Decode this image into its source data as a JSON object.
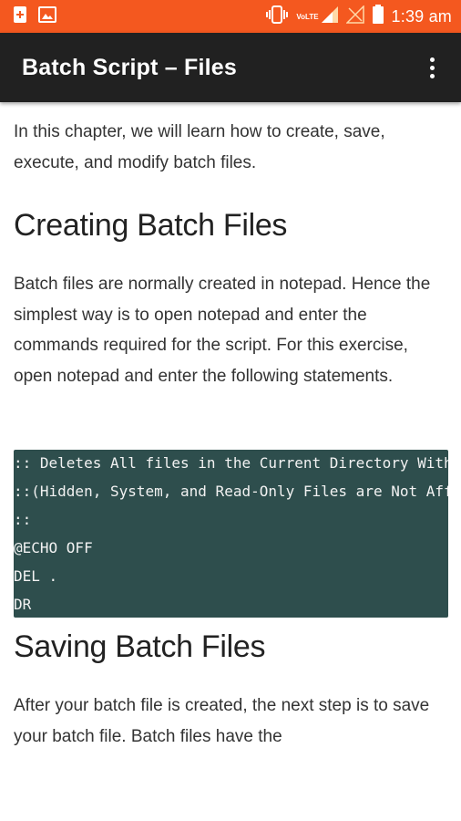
{
  "status_bar": {
    "time": "1:39 am",
    "network_label": "VoLTE",
    "icons": [
      "add-notification-icon",
      "image-notification-icon",
      "vibrate-icon",
      "signal-icon",
      "signal-empty-icon",
      "battery-icon"
    ],
    "background": "#f4581f"
  },
  "app_bar": {
    "title": "Batch Script – Files",
    "overflow_icon": "more-vert-icon",
    "background": "#212121"
  },
  "content": {
    "intro": "In this chapter, we will learn how to create, save, execute, and modify batch files.",
    "section1": {
      "heading": "Creating Batch Files",
      "body": "Batch files are normally created in notepad. Hence the simplest way is to open notepad and enter the commands required for the script. For this exercise, open notepad and enter the following statements."
    },
    "code": {
      "background": "#2e4e4d",
      "lines": [
        ":: Deletes All files in the Current Directory With Prompts and Warnings",
        "::(Hidden, System, and Read-Only Files are Not Affected)",
        "::",
        "@ECHO OFF",
        "DEL .",
        "DR"
      ]
    },
    "section2": {
      "heading": "Saving Batch Files",
      "body": "After your batch file is created, the next step is to save your batch file. Batch files have the"
    }
  }
}
